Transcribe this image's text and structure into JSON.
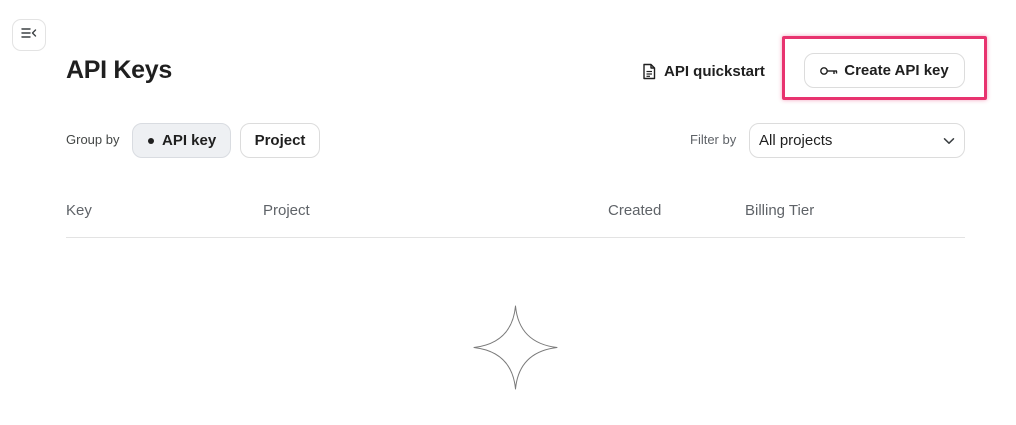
{
  "sidebar": {
    "toggle_icon": "sidebar-collapse-icon"
  },
  "header": {
    "title": "API Keys",
    "quickstart": {
      "label": "API quickstart",
      "icon": "document-icon"
    },
    "create_button": {
      "label": "Create API key",
      "icon": "key-icon"
    }
  },
  "toolbar": {
    "group_by_label": "Group by",
    "group_by_options": [
      {
        "label": "API key",
        "selected": true
      },
      {
        "label": "Project",
        "selected": false
      }
    ],
    "filter_by_label": "Filter by",
    "filter_value": "All projects"
  },
  "table": {
    "columns": [
      "Key",
      "Project",
      "Created",
      "Billing Tier"
    ],
    "rows": []
  },
  "empty_state": {
    "icon": "sparkle-star-icon"
  },
  "colors": {
    "highlight": "#e8336f",
    "selected_chip_bg": "#eef0f3",
    "border": "#dcdcdc",
    "muted_text": "#5f6368"
  }
}
